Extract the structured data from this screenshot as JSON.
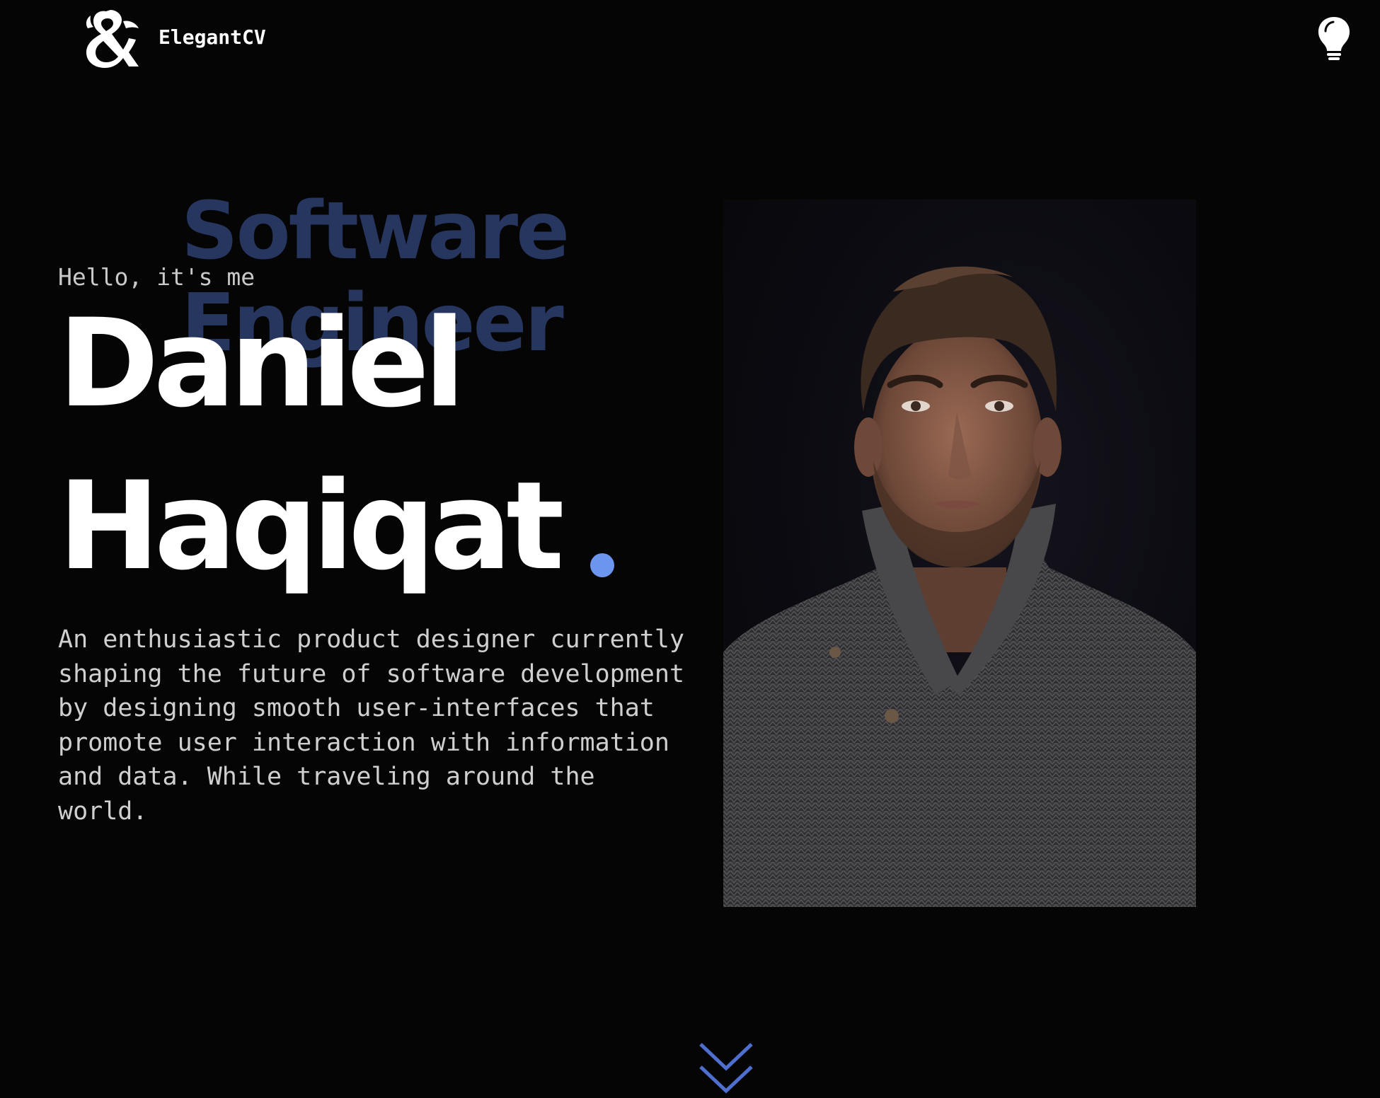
{
  "header": {
    "brand": "ElegantCV",
    "logo_icon": "ampersand-dragon-logo-icon",
    "theme_toggle_icon": "lightbulb-icon"
  },
  "hero": {
    "background_role": "Software\nEngineer",
    "greeting": "Hello, it's me",
    "first_name": "Daniel",
    "last_name": "Haqiqat",
    "intro": "An enthusiastic product designer currently shaping the future of software development by designing smooth user-interfaces that promote user interaction with information and data. While traveling around the world.",
    "portrait_icon": "profile-photo",
    "scroll_icon": "double-chevron-down-icon"
  },
  "colors": {
    "background": "#050506",
    "accent": "#6c95f0",
    "role_text": "#26365f",
    "body_text": "#cfcfcf"
  }
}
